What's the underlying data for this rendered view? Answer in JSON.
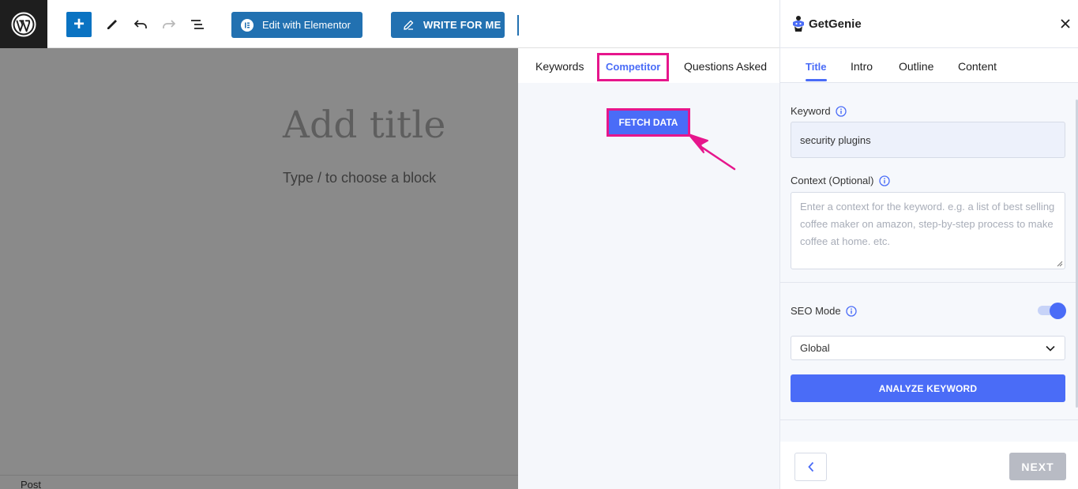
{
  "toolbar": {
    "add_label": "+",
    "elementor_label": "Edit with Elementor",
    "write_label": "WRITE FOR ME"
  },
  "editor": {
    "title_placeholder": "Add title",
    "block_placeholder": "Type / to choose a block",
    "footer_label": "Post"
  },
  "research": {
    "tabs": [
      {
        "label": "Keywords",
        "active": false
      },
      {
        "label": "Competitor",
        "active": true
      },
      {
        "label": "Questions Asked",
        "active": false
      }
    ],
    "fetch_label": "FETCH DATA",
    "highlight_color": "#e6168c"
  },
  "sidebar": {
    "brand": "GetGenie",
    "tabs": [
      {
        "label": "Title",
        "active": true
      },
      {
        "label": "Intro",
        "active": false
      },
      {
        "label": "Outline",
        "active": false
      },
      {
        "label": "Content",
        "active": false
      }
    ],
    "keyword_label": "Keyword",
    "keyword_value": "security plugins",
    "context_label": "Context (Optional)",
    "context_placeholder": "Enter a context for the keyword. e.g. a list of best selling coffee maker on amazon, step-by-step process to make coffee at home. etc.",
    "seo_mode_label": "SEO Mode",
    "seo_mode_on": true,
    "region_value": "Global",
    "analyze_label": "ANALYZE KEYWORD",
    "next_label": "NEXT",
    "accent_color": "#4a6cf7"
  }
}
